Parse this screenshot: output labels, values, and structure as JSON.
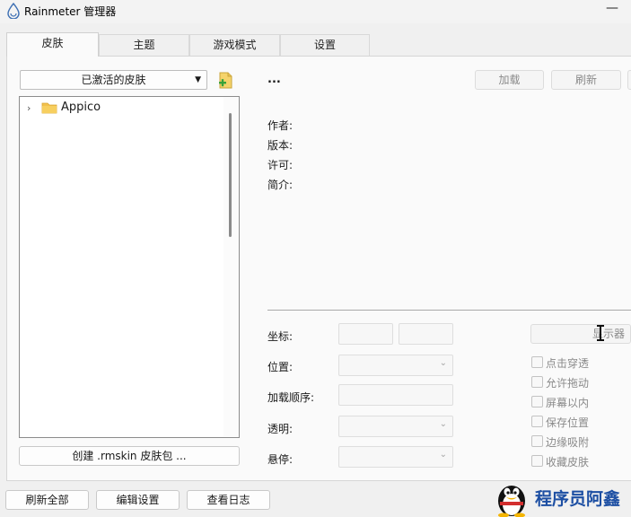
{
  "window": {
    "title": "Rainmeter 管理器",
    "minimize_glyph": "—"
  },
  "tabs": [
    {
      "label": "皮肤",
      "active": true
    },
    {
      "label": "主题",
      "active": false
    },
    {
      "label": "游戏模式",
      "active": false
    },
    {
      "label": "设置",
      "active": false
    }
  ],
  "skins_panel": {
    "filter_selected": "已激活的皮肤",
    "tree_items": [
      {
        "label": "Appico",
        "icon": "folder-icon",
        "expanded": false
      }
    ],
    "create_button": "创建 .rmskin 皮肤包 ..."
  },
  "skin_info": {
    "name": "...",
    "load_button": "加载",
    "refresh_button": "刷新",
    "author_label": "作者:",
    "version_label": "版本:",
    "license_label": "许可:",
    "description_label": "简介:"
  },
  "settings": {
    "coordinates_label": "坐标:",
    "position_label": "位置:",
    "load_order_label": "加载顺序:",
    "transparency_label": "透明:",
    "hover_label": "悬停:",
    "display_button": "显示器",
    "checkboxes": [
      {
        "label": "点击穿透",
        "checked": false
      },
      {
        "label": "允许拖动",
        "checked": false
      },
      {
        "label": "屏幕以内",
        "checked": false
      },
      {
        "label": "保存位置",
        "checked": false
      },
      {
        "label": "边缘吸附",
        "checked": false
      },
      {
        "label": "收藏皮肤",
        "checked": false
      }
    ]
  },
  "footer": {
    "refresh_all_button": "刷新全部",
    "edit_settings_button": "编辑设置",
    "view_log_button": "查看日志"
  },
  "watermark": {
    "text": "程序员阿鑫",
    "logo_icon": "penguin-icon"
  },
  "colors": {
    "accent_folder": "#f2c14e",
    "add_icon_green": "#3aa23a",
    "watermark_blue": "#1d4fa3"
  }
}
